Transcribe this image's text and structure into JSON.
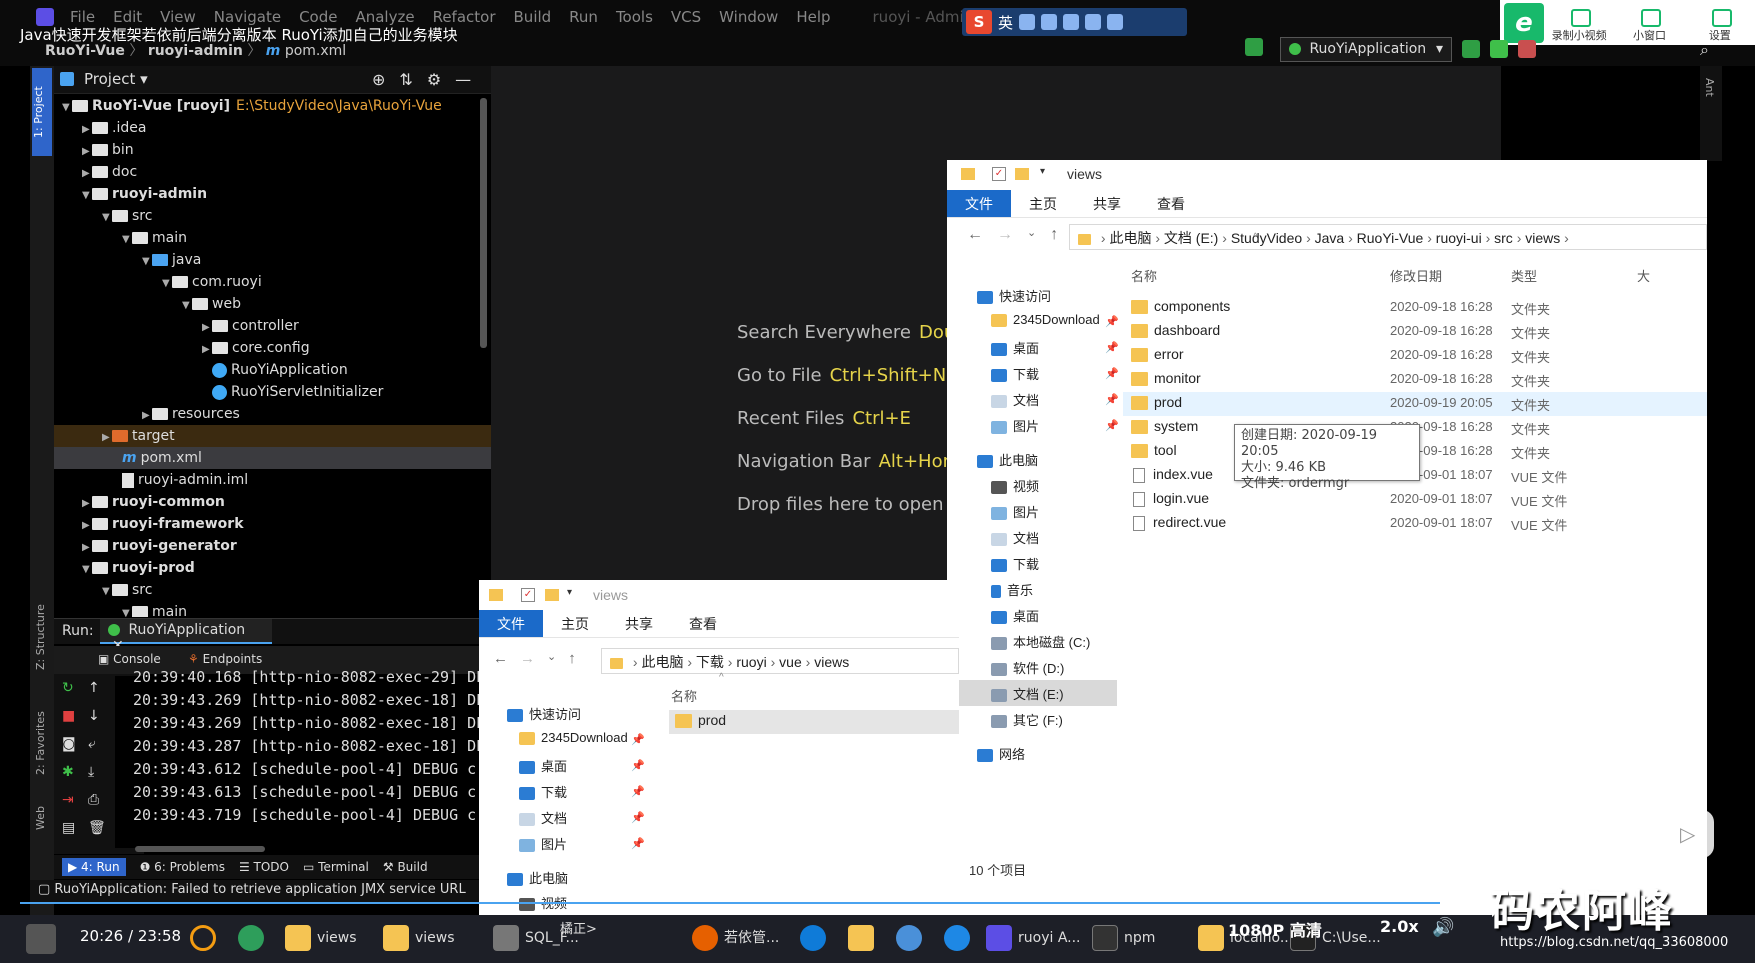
{
  "video": {
    "title": "Java快速开发框架若依前后端分离版本 RuoYi添加自己的业务模块",
    "time": "20:26 / 23:58",
    "watermark": "码农阿峰",
    "url": "https://blog.csdn.net/qq_33608000"
  },
  "ide": {
    "menu": [
      "File",
      "Edit",
      "View",
      "Navigate",
      "Code",
      "Analyze",
      "Refactor",
      "Build",
      "Run",
      "Tools",
      "VCS",
      "Window",
      "Help"
    ],
    "window_title": "ruoyi - Administrator",
    "breadcrumb": [
      "RuoYi-Vue",
      "ruoyi-admin",
      "pom.xml"
    ],
    "run_config": "RuoYiApplication",
    "project_label": "Project",
    "side_tab_project": "1: Project",
    "side_tab_structure": "Z: Structure",
    "side_tab_favorites": "2: Favorites",
    "side_tab_web": "Web",
    "right_tab_ant": "Ant",
    "tree": [
      {
        "label": "RuoYi-Vue [ruoyi]",
        "path": "E:\\StudyVideo\\Java\\RuoYi-Vue"
      },
      {
        "label": ".idea"
      },
      {
        "label": "bin"
      },
      {
        "label": "doc"
      },
      {
        "label": "ruoyi-admin"
      },
      {
        "label": "src"
      },
      {
        "label": "main"
      },
      {
        "label": "java"
      },
      {
        "label": "com.ruoyi"
      },
      {
        "label": "web"
      },
      {
        "label": "controller"
      },
      {
        "label": "core.config"
      },
      {
        "label": "RuoYiApplication"
      },
      {
        "label": "RuoYiServletInitializer"
      },
      {
        "label": "resources"
      },
      {
        "label": "target"
      },
      {
        "label": "pom.xml"
      },
      {
        "label": "ruoyi-admin.iml"
      },
      {
        "label": "ruoyi-common"
      },
      {
        "label": "ruoyi-framework"
      },
      {
        "label": "ruoyi-generator"
      },
      {
        "label": "ruoyi-prod"
      },
      {
        "label": "src"
      },
      {
        "label": "main"
      }
    ],
    "hints": [
      {
        "text": "Search Everywhere",
        "key": "Doub"
      },
      {
        "text": "Go to File",
        "key": "Ctrl+Shift+N"
      },
      {
        "text": "Recent Files",
        "key": "Ctrl+E"
      },
      {
        "text": "Navigation Bar",
        "key": "Alt+Home"
      },
      {
        "text": "Drop files here to open",
        "key": ""
      }
    ],
    "run": {
      "label": "Run:",
      "tab": "RuoYiApplication",
      "console_tab": "Console",
      "endpoints_tab": "Endpoints",
      "logs": [
        "20:39:40.168 [http-nio-8082-exec-29] DE",
        "20:39:43.269 [http-nio-8082-exec-18] DE",
        "20:39:43.269 [http-nio-8082-exec-18] DE",
        "20:39:43.287 [http-nio-8082-exec-18] DE",
        "20:39:43.612 [schedule-pool-4] DEBUG c.",
        "20:39:43.613 [schedule-pool-4] DEBUG c.",
        "20:39:43.719 [schedule-pool-4] DEBUG c."
      ]
    },
    "bottom_tabs": [
      "4: Run",
      "6: Problems",
      "TODO",
      "Terminal",
      "Build"
    ],
    "status": "RuoYiApplication: Failed to retrieve application JMX service URL"
  },
  "explorer_right": {
    "title": "views",
    "ribbon": [
      "文件",
      "主页",
      "共享",
      "查看"
    ],
    "address": [
      "此电脑",
      "文档 (E:)",
      "StudyVideo",
      "Java",
      "RuoYi-Vue",
      "ruoyi-ui",
      "src",
      "views"
    ],
    "nav": [
      {
        "label": "快速访问",
        "pin": false
      },
      {
        "label": "2345Download",
        "pin": true
      },
      {
        "label": "桌面",
        "pin": true
      },
      {
        "label": "下载",
        "pin": true
      },
      {
        "label": "文档",
        "pin": true
      },
      {
        "label": "图片",
        "pin": true
      },
      {
        "label": "此电脑",
        "pin": false
      },
      {
        "label": "视频",
        "pin": false
      },
      {
        "label": "图片",
        "pin": false
      },
      {
        "label": "文档",
        "pin": false
      },
      {
        "label": "下载",
        "pin": false
      },
      {
        "label": "音乐",
        "pin": false
      },
      {
        "label": "桌面",
        "pin": false
      },
      {
        "label": "本地磁盘 (C:)",
        "pin": false
      },
      {
        "label": "软件 (D:)",
        "pin": false
      },
      {
        "label": "文档 (E:)",
        "pin": false
      },
      {
        "label": "其它 (F:)",
        "pin": false
      },
      {
        "label": "网络",
        "pin": false
      }
    ],
    "columns": [
      "名称",
      "修改日期",
      "类型",
      "大"
    ],
    "files": [
      {
        "name": "components",
        "date": "2020-09-18 16:28",
        "type": "文件夹",
        "kind": "folder"
      },
      {
        "name": "dashboard",
        "date": "2020-09-18 16:28",
        "type": "文件夹",
        "kind": "folder"
      },
      {
        "name": "error",
        "date": "2020-09-18 16:28",
        "type": "文件夹",
        "kind": "folder"
      },
      {
        "name": "monitor",
        "date": "2020-09-18 16:28",
        "type": "文件夹",
        "kind": "folder"
      },
      {
        "name": "prod",
        "date": "2020-09-19 20:05",
        "type": "文件夹",
        "kind": "folder"
      },
      {
        "name": "system",
        "date": "2020-09-18 16:28",
        "type": "文件夹",
        "kind": "folder"
      },
      {
        "name": "tool",
        "date": "2020-09-18 16:28",
        "type": "文件夹",
        "kind": "folder"
      },
      {
        "name": "index.vue",
        "date": "2020-09-01 18:07",
        "type": "VUE 文件",
        "kind": "file"
      },
      {
        "name": "login.vue",
        "date": "2020-09-01 18:07",
        "type": "VUE 文件",
        "kind": "file"
      },
      {
        "name": "redirect.vue",
        "date": "2020-09-01 18:07",
        "type": "VUE 文件",
        "kind": "file"
      }
    ],
    "tooltip": [
      "创建日期: 2020-09-19 20:05",
      "大小: 9.46 KB",
      "文件夹: ordermgr"
    ],
    "item_count": "10 个项目"
  },
  "explorer_left": {
    "title": "views",
    "ribbon": [
      "文件",
      "主页",
      "共享",
      "查看"
    ],
    "address": [
      "此电脑",
      "下载",
      "ruoyi",
      "vue",
      "views"
    ],
    "nav": [
      {
        "label": "快速访问",
        "pin": false
      },
      {
        "label": "2345Download",
        "pin": true
      },
      {
        "label": "桌面",
        "pin": true
      },
      {
        "label": "下载",
        "pin": true
      },
      {
        "label": "文档",
        "pin": true
      },
      {
        "label": "图片",
        "pin": true
      },
      {
        "label": "此电脑",
        "pin": false
      },
      {
        "label": "视频",
        "pin": false
      }
    ],
    "column": "名称",
    "files": [
      {
        "name": "prod"
      }
    ]
  },
  "recorder": {
    "record_label": "录制小视频",
    "mini_label": "小窗口",
    "settings_label": "设置"
  },
  "sogou": {
    "mode": "英"
  },
  "taskbar": {
    "items": [
      "views",
      "views",
      "SQL_F...",
      "若依管...",
      "ruoyi A...",
      "npm",
      "localho...",
      "C:\\Use..."
    ],
    "overlay": [
      "1080P 高清",
      "2.0x",
      "橘正>"
    ]
  }
}
